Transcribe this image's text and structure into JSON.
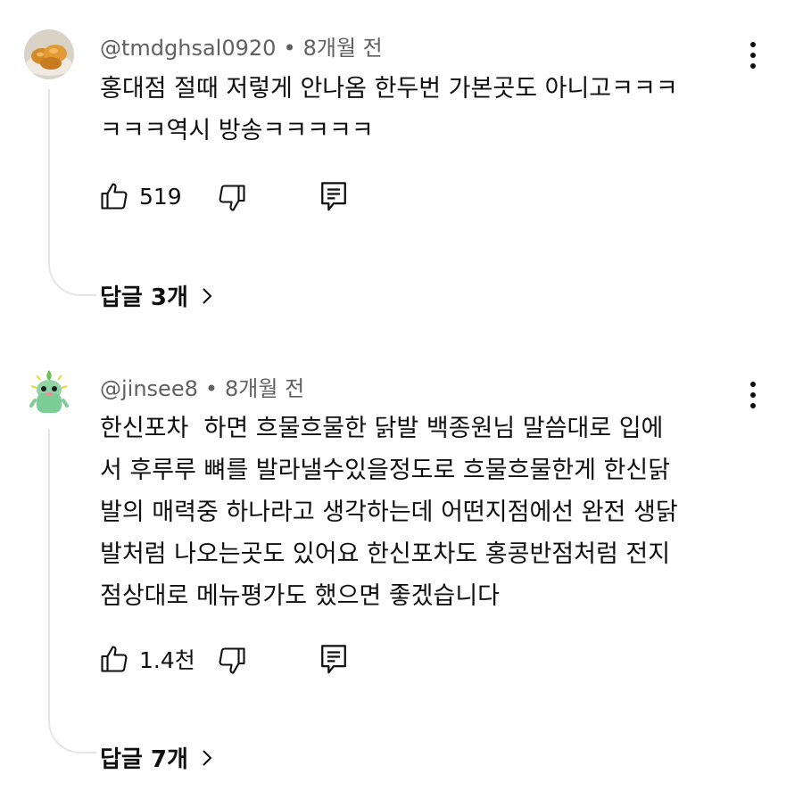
{
  "comments": [
    {
      "author": "@tmdghsal0920",
      "separator": "•",
      "time": "8개월 전",
      "text": "홍대점 절때 저렇게 안나옴 한두번 가본곳도 아니고ㅋㅋㅋ\nㅋㅋㅋ역시 방송ㅋㅋㅋㅋㅋ",
      "likes": "519",
      "replies_label": "답글 3개",
      "avatar_icon": "fried-chicken-avatar"
    },
    {
      "author": "@jinsee8",
      "separator": "•",
      "time": "8개월 전",
      "text": "한신포차  하면 흐물흐물한 닭발 백종원님 말씀대로 입에\n서 후루루 뼈를 발라낼수있을정도로 흐물흐물한게 한신닭\n발의 매력중 하나라고 생각하는데 어떤지점에선 완전 생닭\n발처럼 나오는곳도 있어요 한신포차도 홍콩반점처럼 전지\n점상대로 메뉴평가도 했으면 좋겠습니다",
      "likes": "1.4천",
      "replies_label": "답글 7개",
      "avatar_icon": "green-cartoon-avatar"
    }
  ],
  "icons": {
    "like": "thumbs-up-icon",
    "dislike": "thumbs-down-icon",
    "reply": "reply-icon",
    "more": "more-vert-icon",
    "chevron": "chevron-right-icon"
  }
}
